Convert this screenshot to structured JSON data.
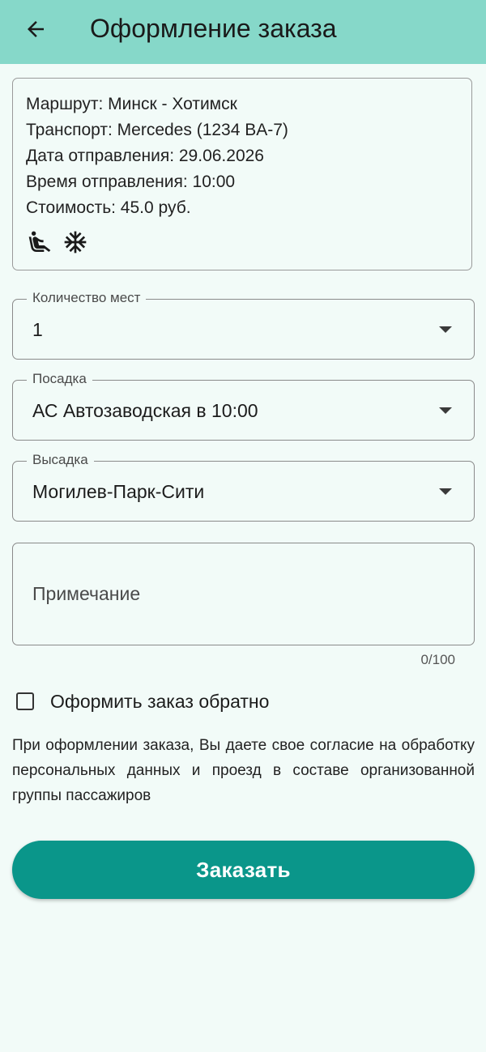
{
  "appbar": {
    "title": "Оформление заказа",
    "back_icon": "arrow-left-icon"
  },
  "trip_info": {
    "route": "Маршрут: Минск - Хотимск",
    "transport": "Транспорт: Mercedes (1234 BA-7)",
    "departure_date": "Дата отправления: 29.06.2026",
    "departure_time": "Время отправления: 10:00",
    "price": "Стоимость: 45.0 руб.",
    "feature_icons": [
      "reclining-seat-icon",
      "snowflake-icon"
    ]
  },
  "seats": {
    "label": "Количество мест",
    "value": "1"
  },
  "boarding": {
    "label": "Посадка",
    "value": "АС Автозаводская в 10:00"
  },
  "dropoff": {
    "label": "Высадка",
    "value": "Могилев-Парк-Сити"
  },
  "note": {
    "placeholder": "Примечание",
    "counter": "0/100"
  },
  "return_order": {
    "label": "Оформить заказ обратно",
    "checked": false
  },
  "consent_text": "При оформлении заказа, Вы даете свое согласие на обработку персональных данных и проезд в составе организованной группы пассажиров",
  "order_button": {
    "label": "Заказать"
  },
  "colors": {
    "appbar": "#86d8c9",
    "background": "#f2fbf8",
    "accent": "#0a968a"
  }
}
